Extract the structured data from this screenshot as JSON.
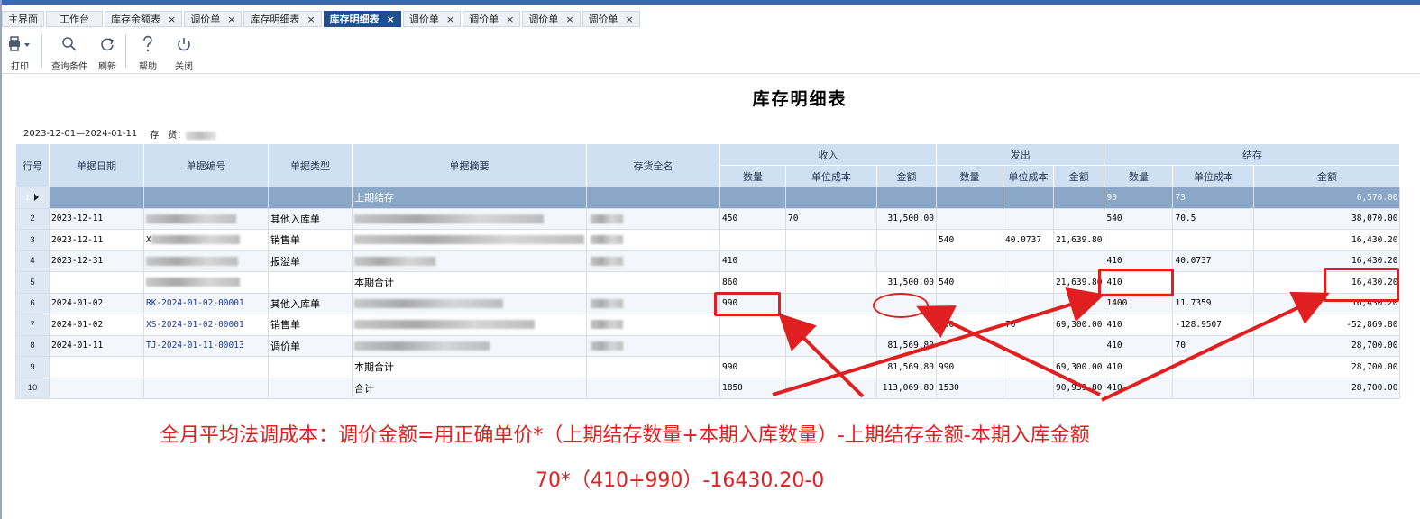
{
  "tabs": [
    {
      "label": "主界面",
      "closable": false,
      "active": false
    },
    {
      "label": "工作台",
      "closable": false,
      "active": false
    },
    {
      "label": "库存余额表",
      "closable": true,
      "active": false
    },
    {
      "label": "调价单",
      "closable": true,
      "active": false
    },
    {
      "label": "库存明细表",
      "closable": true,
      "active": false
    },
    {
      "label": "库存明细表",
      "closable": true,
      "active": true
    },
    {
      "label": "调价单",
      "closable": true,
      "active": false
    },
    {
      "label": "调价单",
      "closable": true,
      "active": false
    },
    {
      "label": "调价单",
      "closable": true,
      "active": false
    },
    {
      "label": "调价单",
      "closable": true,
      "active": false
    }
  ],
  "tab_close_glyph": "×",
  "toolbar": {
    "print": "打印",
    "query": "查询条件",
    "refresh": "刷新",
    "help": "帮助",
    "close": "关闭"
  },
  "report": {
    "title": "库存明细表",
    "date_range": "2023-12-01—2024-01-11",
    "inventory_label": "存　货：",
    "inventory_value_blurred": true
  },
  "columns": {
    "row_no": "行号",
    "date": "单据日期",
    "doc_no": "单据编号",
    "doc_type": "单据类型",
    "summary": "单据摘要",
    "item_name": "存货全名",
    "in_group": "收入",
    "out_group": "发出",
    "bal_group": "结存",
    "qty": "数量",
    "unit_cost": "单位成本",
    "amount": "金额"
  },
  "rows": [
    {
      "no": "1",
      "date": "",
      "doc": "",
      "type": "",
      "summary": "上期结存",
      "in_q": "",
      "in_c": "",
      "in_a": "",
      "out_q": "",
      "out_c": "",
      "out_a": "",
      "b_q": "90",
      "b_c": "73",
      "b_a": "6,570.00",
      "selected": true
    },
    {
      "no": "2",
      "date": "2023-12-11",
      "doc": "",
      "type": "其他入库单",
      "summary": "",
      "in_q": "450",
      "in_c": "70",
      "in_a": "31,500.00",
      "out_q": "",
      "out_c": "",
      "out_a": "",
      "b_q": "540",
      "b_c": "70.5",
      "b_a": "38,070.00"
    },
    {
      "no": "3",
      "date": "2023-12-11",
      "doc": "X",
      "type": "销售单",
      "summary": "",
      "in_q": "",
      "in_c": "",
      "in_a": "",
      "out_q": "540",
      "out_c": "40.0737",
      "out_a": "21,639.80",
      "b_q": "",
      "b_c": "",
      "b_a": "16,430.20"
    },
    {
      "no": "4",
      "date": "2023-12-31",
      "doc": "",
      "type": "报溢单",
      "summary": "",
      "in_q": "410",
      "in_c": "",
      "in_a": "",
      "out_q": "",
      "out_c": "",
      "out_a": "",
      "b_q": "410",
      "b_c": "40.0737",
      "b_a": "16,430.20"
    },
    {
      "no": "5",
      "date": "",
      "doc": "",
      "type": "",
      "summary": "本期合计",
      "in_q": "860",
      "in_c": "",
      "in_a": "31,500.00",
      "out_q": "540",
      "out_c": "",
      "out_a": "21,639.80",
      "b_q": "410",
      "b_c": "",
      "b_a": "16,430.20"
    },
    {
      "no": "6",
      "date": "2024-01-02",
      "doc": "RK-2024-01-02-00001",
      "type": "其他入库单",
      "summary": "",
      "in_q": "990",
      "in_c": "",
      "in_a": "",
      "out_q": "",
      "out_c": "",
      "out_a": "",
      "b_q": "1400",
      "b_c": "11.7359",
      "b_a": "16,430.20"
    },
    {
      "no": "7",
      "date": "2024-01-02",
      "doc": "XS-2024-01-02-00001",
      "type": "销售单",
      "summary": "",
      "in_q": "",
      "in_c": "",
      "in_a": "",
      "out_q": "990",
      "out_c": "70",
      "out_a": "69,300.00",
      "b_q": "410",
      "b_c": "-128.9507",
      "b_a": "-52,869.80"
    },
    {
      "no": "8",
      "date": "2024-01-11",
      "doc": "TJ-2024-01-11-00013",
      "type": "调价单",
      "summary": "",
      "in_q": "",
      "in_c": "",
      "in_a": "81,569.80",
      "out_q": "",
      "out_c": "",
      "out_a": "",
      "b_q": "410",
      "b_c": "70",
      "b_a": "28,700.00"
    },
    {
      "no": "9",
      "date": "",
      "doc": "",
      "type": "",
      "summary": "本期合计",
      "in_q": "990",
      "in_c": "",
      "in_a": "81,569.80",
      "out_q": "990",
      "out_c": "",
      "out_a": "69,300.00",
      "b_q": "410",
      "b_c": "",
      "b_a": "28,700.00"
    },
    {
      "no": "10",
      "date": "",
      "doc": "",
      "type": "",
      "summary": "合计",
      "in_q": "1850",
      "in_c": "",
      "in_a": "113,069.80",
      "out_q": "1530",
      "out_c": "",
      "out_a": "90,939.80",
      "b_q": "410",
      "b_c": "",
      "b_a": "28,700.00"
    }
  ],
  "annotation": {
    "formula": "全月平均法调成本：调价金额=用正确单价*（上期结存数量+本期入库数量）-上期结存金额-本期入库金额",
    "example": "70*（410+990）-16430.20-0",
    "color": "#e02020"
  },
  "colors": {
    "active_tab": "#1f4f8f",
    "header_bg": "#cfe0f2",
    "selected_row": "#8aa7c8",
    "doc_link": "#1d3b9a"
  }
}
